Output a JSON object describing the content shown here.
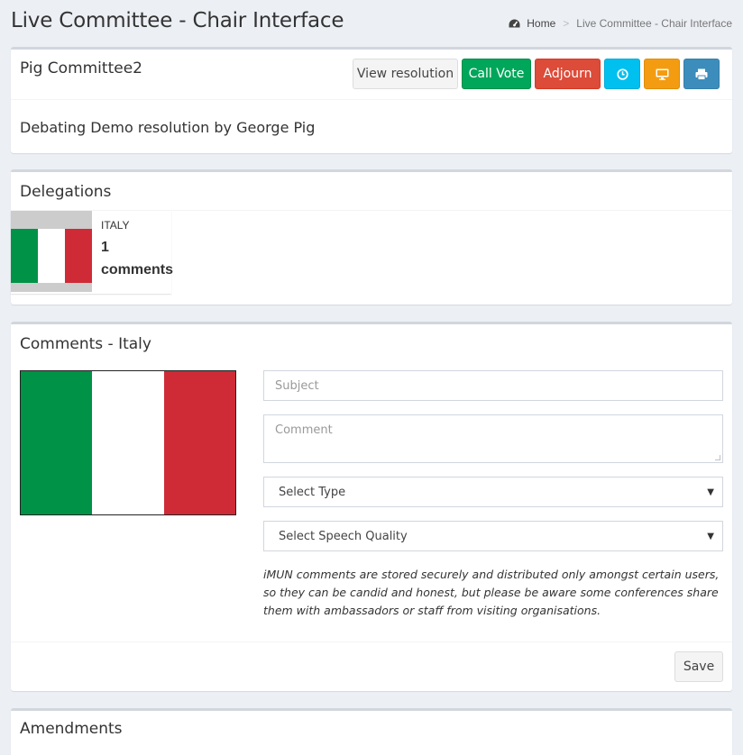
{
  "page": {
    "title": "Live Committee - Chair Interface",
    "breadcrumb": {
      "home": "Home",
      "current": "Live Committee - Chair Interface"
    }
  },
  "committee": {
    "name": "Pig Committee2",
    "debating": "Debating Demo resolution by George Pig",
    "buttons": {
      "view_resolution": "View resolution",
      "call_vote": "Call Vote",
      "adjourn": "Adjourn"
    },
    "icon_buttons": [
      "clock-icon",
      "monitor-icon",
      "print-icon"
    ]
  },
  "delegations": {
    "title": "Delegations",
    "items": [
      {
        "country": "ITALY",
        "count": "1",
        "count_label": "comments"
      }
    ]
  },
  "comments": {
    "title": "Comments - Italy",
    "subject_placeholder": "Subject",
    "comment_placeholder": "Comment",
    "type_select": "Select Type",
    "quality_select": "Select Speech Quality",
    "note": "iMUN comments are stored securely and distributed only amongst certain users, so they can be candid and honest, but please be aware some conferences share them with ambassadors or staff from visiting organisations.",
    "save_label": "Save"
  },
  "amendments": {
    "title": "Amendments"
  },
  "colors": {
    "success": "#00a65a",
    "danger": "#dd4b39",
    "info": "#00c0ef",
    "warning": "#f39c12",
    "primary": "#3c8dbc",
    "italy_green": "#009246",
    "italy_red": "#ce2b37"
  }
}
